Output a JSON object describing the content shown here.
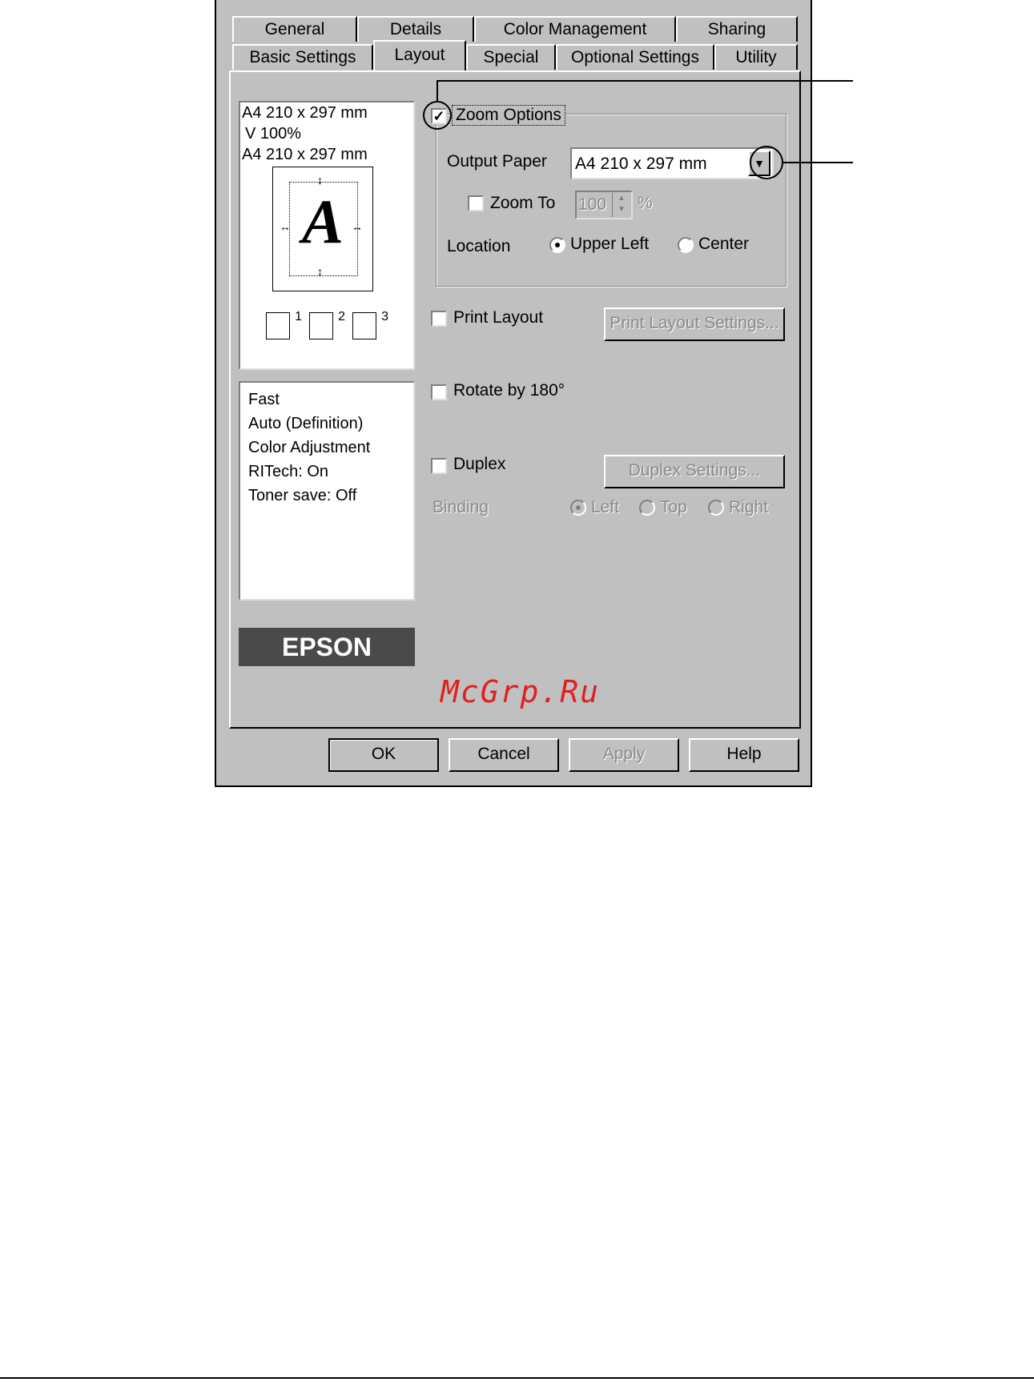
{
  "tabs_row1": [
    "General",
    "Details",
    "Color Management",
    "Sharing"
  ],
  "tabs_row2": [
    "Basic Settings",
    "Layout",
    "Special",
    "Optional Settings",
    "Utility"
  ],
  "preview": {
    "line1": "A4 210 x 297 mm",
    "line2": "V 100%",
    "line3": "A4 210 x 297 mm",
    "letter": "A",
    "copies": [
      "1",
      "2",
      "3"
    ]
  },
  "info_lines": [
    "Fast",
    "Auto (Definition)",
    "Color Adjustment",
    "RITech: On",
    "Toner save: Off"
  ],
  "brand": "EPSON",
  "zoom": {
    "checkbox_label": "Zoom Options",
    "checked": true,
    "output_paper_label": "Output Paper",
    "output_paper_value": "A4 210 x 297 mm",
    "zoom_to_label": "Zoom To",
    "zoom_value": "100",
    "zoom_unit": "%",
    "location_label": "Location",
    "location_options": [
      "Upper Left",
      "Center"
    ],
    "location_selected": "Upper Left"
  },
  "print_layout": {
    "label": "Print Layout",
    "button": "Print Layout Settings..."
  },
  "rotate": {
    "label": "Rotate by 180°"
  },
  "duplex": {
    "label": "Duplex",
    "button": "Duplex Settings...",
    "binding_label": "Binding",
    "binding_options": [
      "Left",
      "Top",
      "Right"
    ],
    "binding_selected": "Left"
  },
  "watermark": "McGrp.Ru",
  "buttons": {
    "ok": "OK",
    "cancel": "Cancel",
    "apply": "Apply",
    "help": "Help"
  }
}
